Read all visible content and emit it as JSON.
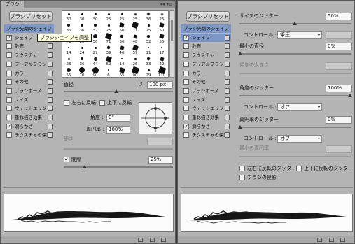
{
  "left_panel": {
    "tab": "ブラシ",
    "tab_controls": "◂◂ ▾≡",
    "preset_button": "ブラシプリセット",
    "categories": [
      {
        "label": "ブラシ先端のシェイプ",
        "checked": null,
        "selected": true
      },
      {
        "label": "シェイプ",
        "checked": true,
        "selected": false
      },
      {
        "label": "散布",
        "checked": false,
        "selected": false
      },
      {
        "label": "テクスチャ",
        "checked": false,
        "selected": false
      },
      {
        "label": "デュアルブラシ",
        "checked": false,
        "selected": false
      },
      {
        "label": "カラー",
        "checked": false,
        "selected": false
      },
      {
        "label": "その他",
        "checked": false,
        "selected": false
      },
      {
        "label": "ブラシポーズ",
        "checked": false,
        "selected": false
      },
      {
        "label": "ノイズ",
        "checked": false,
        "selected": false
      },
      {
        "label": "ウェットエッジ",
        "checked": false,
        "selected": false
      },
      {
        "label": "重ね描き効果",
        "checked": false,
        "selected": false
      },
      {
        "label": "滑らかさ",
        "checked": true,
        "selected": false
      },
      {
        "label": "テクスチャの保護",
        "checked": false,
        "selected": false
      }
    ],
    "tooltip": "ブラシシェイプを調整",
    "brush_sizes": [
      "30",
      "30",
      "30",
      "25",
      "25",
      "25",
      "36",
      "25",
      "36",
      "36",
      "32",
      "25",
      "50",
      "71",
      "25",
      "50",
      "71",
      "25",
      "50",
      "71",
      "36",
      "48",
      "32",
      "55",
      "14",
      "24",
      "27",
      "39",
      "46",
      "59",
      "11",
      "17",
      "23",
      "36",
      "44",
      "60",
      "14",
      "26",
      "33",
      "42",
      "55",
      "70",
      "90",
      "6",
      "65",
      "90",
      "29",
      "110"
    ],
    "diameter_label": "直径",
    "diameter_value": "100 px",
    "flip_x_label": "左右に反転",
    "flip_y_label": "上下に反転",
    "angle_label": "角度 :",
    "angle_value": "0°",
    "roundness_label": "真円率 :",
    "roundness_value": "100%",
    "hardness_label": "硬さ",
    "spacing_label": "間隔",
    "spacing_checked": true,
    "spacing_value": "25%"
  },
  "right_panel": {
    "preset_button": "ブラシプリセット",
    "categories": [
      {
        "label": "ブラシ先端のシェイプ",
        "checked": null,
        "selected": false
      },
      {
        "label": "シェイプ",
        "checked": true,
        "selected": true
      },
      {
        "label": "散布",
        "checked": false,
        "selected": false
      },
      {
        "label": "テクスチャ",
        "checked": false,
        "selected": false
      },
      {
        "label": "デュアルブラシ",
        "checked": false,
        "selected": false
      },
      {
        "label": "カラー",
        "checked": false,
        "selected": false
      },
      {
        "label": "その他",
        "checked": false,
        "selected": false
      },
      {
        "label": "ブラシポーズ",
        "checked": false,
        "selected": false
      },
      {
        "label": "ノイズ",
        "checked": false,
        "selected": false
      },
      {
        "label": "ウェットエッジ",
        "checked": false,
        "selected": false
      },
      {
        "label": "重ね描き効果",
        "checked": false,
        "selected": false
      },
      {
        "label": "滑らかさ",
        "checked": true,
        "selected": false
      },
      {
        "label": "テクスチャの保護",
        "checked": false,
        "selected": false
      }
    ],
    "size_jitter_label": "サイズのジッター",
    "size_jitter_value": "50%",
    "control_label": "コントロール :",
    "size_control_value": "筆圧",
    "min_diameter_label": "最小の直径",
    "min_diameter_value": "0%",
    "tilt_scale_label": "傾きの大きさ",
    "angle_jitter_label": "角度のジッター",
    "angle_jitter_value": "100%",
    "angle_control_value": "オフ",
    "roundness_jitter_label": "真円率のジッター",
    "roundness_jitter_value": "0%",
    "roundness_control_value": "オフ",
    "min_roundness_label": "最小の真円率",
    "flip_x_jitter_label": "左右に反転のジッター",
    "flip_y_jitter_label": "上下に反転のジッター",
    "brush_projection_label": "ブラシの投影"
  }
}
